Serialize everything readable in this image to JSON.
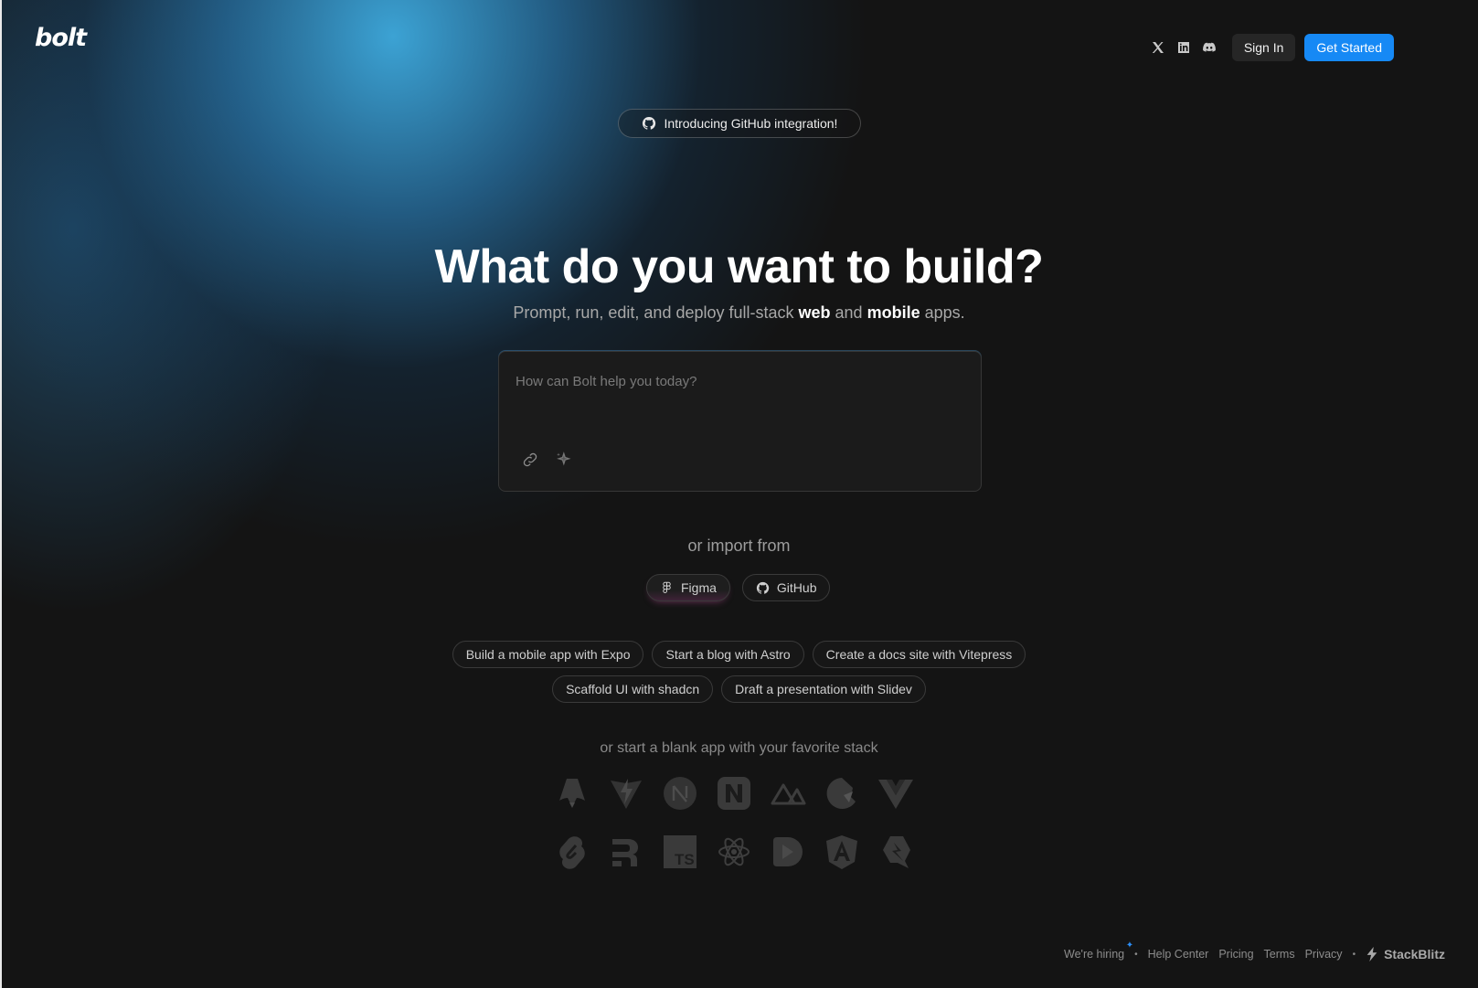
{
  "header": {
    "logo": "bolt",
    "social_icons": [
      "x-icon",
      "linkedin-icon",
      "discord-icon"
    ],
    "signin_label": "Sign In",
    "get_started_label": "Get Started"
  },
  "announcement": {
    "label": "Introducing GitHub integration!",
    "icon": "github-icon"
  },
  "hero": {
    "title": "What do you want to build?",
    "subtitle_pre": "Prompt, run, edit, and deploy full-stack ",
    "subtitle_web": "web",
    "subtitle_mid": " and ",
    "subtitle_mobile": "mobile",
    "subtitle_post": " apps."
  },
  "prompt": {
    "placeholder": "How can Bolt help you today?",
    "tools": [
      "link-icon",
      "sparkle-icon"
    ]
  },
  "import": {
    "label": "or import from",
    "figma": "Figma",
    "github": "GitHub"
  },
  "suggestions": {
    "row1": [
      "Build a mobile app with Expo",
      "Start a blog with Astro",
      "Create a docs site with Vitepress"
    ],
    "row2": [
      "Scaffold UI with shadcn",
      "Draft a presentation with Slidev"
    ]
  },
  "stack": {
    "label": "or start a blank app with your favorite stack",
    "icons": [
      "astro-icon",
      "vite-icon",
      "next-icon",
      "nuxt-n-icon",
      "nuxt-icon",
      "qwik-icon",
      "vue-icon",
      "svelte-icon",
      "remix-icon",
      "typescript-icon",
      "react-icon",
      "slidev-icon",
      "analog-icon",
      "qwik-alt-icon"
    ]
  },
  "footer": {
    "hiring": "We're hiring",
    "help": "Help Center",
    "pricing": "Pricing",
    "terms": "Terms",
    "privacy": "Privacy",
    "brand": "StackBlitz"
  },
  "colors": {
    "accent": "#1689f5",
    "background": "#141414",
    "glow": "#3eaade"
  }
}
